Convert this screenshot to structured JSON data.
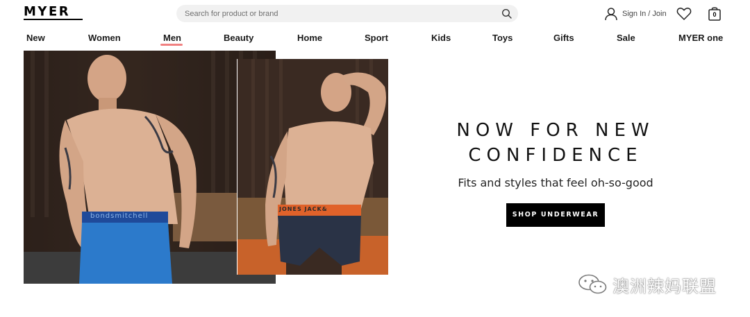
{
  "header": {
    "logo": "MYER",
    "search_placeholder": "Search for product or brand",
    "account_label": "Sign In / Join",
    "bag_count": "0"
  },
  "nav": {
    "items": [
      {
        "label": "New"
      },
      {
        "label": "Women"
      },
      {
        "label": "Men"
      },
      {
        "label": "Beauty"
      },
      {
        "label": "Home"
      },
      {
        "label": "Sport"
      },
      {
        "label": "Kids"
      },
      {
        "label": "Toys"
      },
      {
        "label": "Gifts"
      },
      {
        "label": "Sale"
      },
      {
        "label": "MYER one"
      }
    ],
    "active": "Men",
    "accent_color": "#f08080"
  },
  "hero": {
    "headline_line1": "NOW FOR NEW",
    "headline_line2": "CONFIDENCE",
    "subhead": "Fits and styles that feel oh-so-good",
    "cta_label": "SHOP UNDERWEAR",
    "left_band_text": "bondsmitchell",
    "right_band_text": "JONES JACK&"
  },
  "watermark": {
    "text": "澳洲辣妈联盟"
  }
}
